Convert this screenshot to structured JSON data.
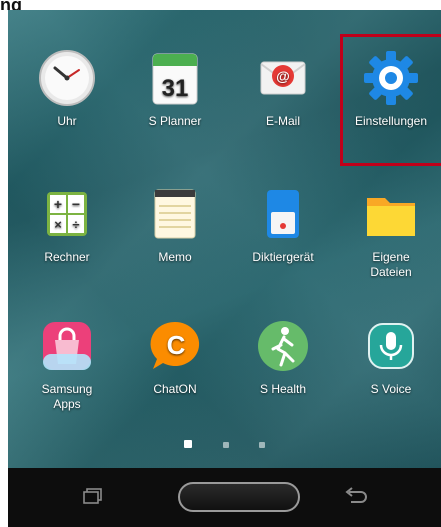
{
  "top_caption": "ng",
  "apps": [
    {
      "label": "Uhr",
      "icon": "clock-icon"
    },
    {
      "label": "S Planner",
      "icon": "calendar-icon",
      "calendar_day": "31"
    },
    {
      "label": "E-Mail",
      "icon": "email-icon"
    },
    {
      "label": "Einstellungen",
      "icon": "settings-gear-icon"
    },
    {
      "label": "Rechner",
      "icon": "calculator-icon"
    },
    {
      "label": "Memo",
      "icon": "memo-icon"
    },
    {
      "label": "Diktiergerät",
      "icon": "voice-recorder-icon"
    },
    {
      "label": "Eigene Dateien",
      "icon": "folder-icon"
    },
    {
      "label": "Samsung Apps",
      "icon": "samsung-apps-icon"
    },
    {
      "label": "ChatON",
      "icon": "chaton-icon",
      "letter": "C"
    },
    {
      "label": "S Health",
      "icon": "s-health-icon"
    },
    {
      "label": "S Voice",
      "icon": "microphone-icon"
    }
  ],
  "page_indicator": {
    "pages": 3,
    "current": 1
  },
  "highlight_color": "#c0001a"
}
